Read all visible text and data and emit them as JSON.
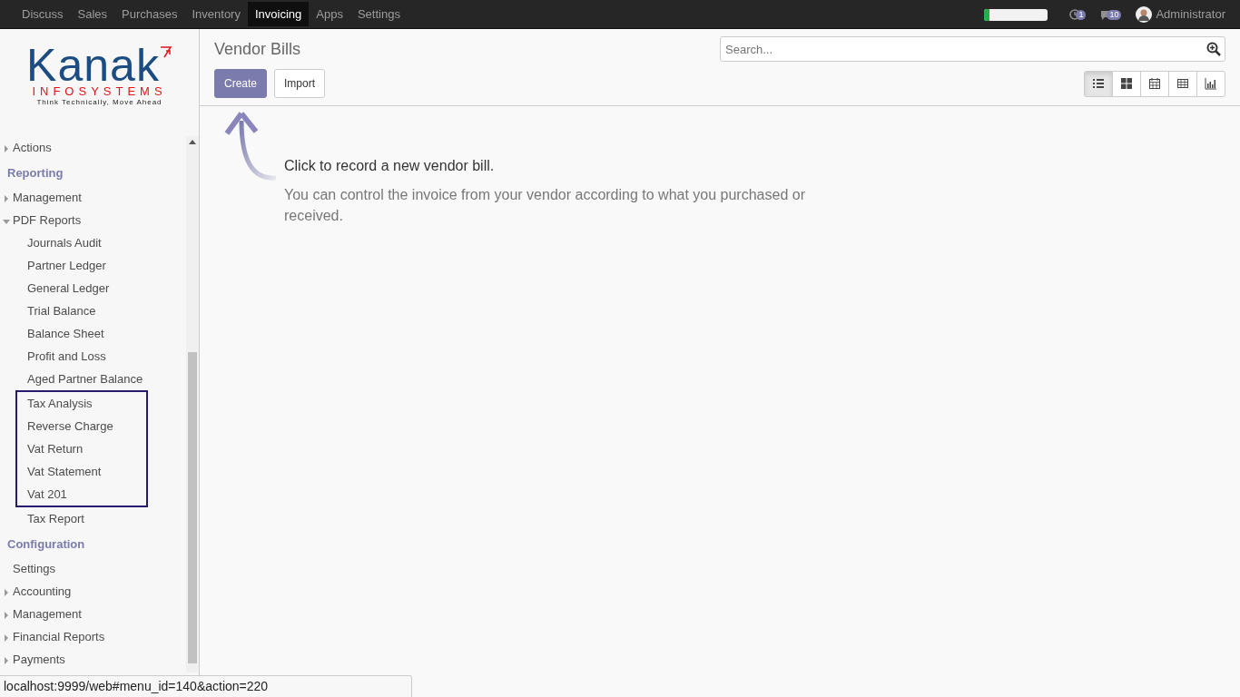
{
  "top_menu": [
    {
      "label": "Discuss",
      "selected": false
    },
    {
      "label": "Sales",
      "selected": false
    },
    {
      "label": "Purchases",
      "selected": false
    },
    {
      "label": "Inventory",
      "selected": false
    },
    {
      "label": "Invoicing",
      "selected": true
    },
    {
      "label": "Apps",
      "selected": false
    },
    {
      "label": "Settings",
      "selected": false
    }
  ],
  "systray": {
    "progress": {
      "level": 0.08
    },
    "activity_count": "1",
    "message_count": "10",
    "user": "Administrator"
  },
  "logo": {
    "name": "Kanak",
    "subtitle": "INFOSYSTEMS",
    "tagline": "Think Technically, Move Ahead"
  },
  "sidebar": {
    "entries": [
      {
        "kind": "folder",
        "label": "Actions",
        "expanded": false
      },
      {
        "kind": "header",
        "label": "Reporting"
      },
      {
        "kind": "folder",
        "label": "Management",
        "expanded": false
      },
      {
        "kind": "folder",
        "label": "PDF Reports",
        "expanded": true,
        "children": [
          {
            "label": "Journals Audit",
            "highlighted": false
          },
          {
            "label": "Partner Ledger",
            "highlighted": false
          },
          {
            "label": "General Ledger",
            "highlighted": false
          },
          {
            "label": "Trial Balance",
            "highlighted": false
          },
          {
            "label": "Balance Sheet",
            "highlighted": false
          },
          {
            "label": "Profit and Loss",
            "highlighted": false
          },
          {
            "label": "Aged Partner Balance",
            "highlighted": false
          },
          {
            "label": "Tax Analysis",
            "highlighted": true
          },
          {
            "label": "Reverse Charge",
            "highlighted": true
          },
          {
            "label": "Vat Return",
            "highlighted": true
          },
          {
            "label": "Vat Statement",
            "highlighted": true
          },
          {
            "label": "Vat 201",
            "highlighted": true
          },
          {
            "label": "Tax Report",
            "highlighted": false
          }
        ]
      },
      {
        "kind": "header",
        "label": "Configuration"
      },
      {
        "kind": "link",
        "label": "Settings"
      },
      {
        "kind": "folder",
        "label": "Accounting",
        "expanded": false
      },
      {
        "kind": "folder",
        "label": "Management",
        "expanded": false
      },
      {
        "kind": "folder",
        "label": "Financial Reports",
        "expanded": false
      },
      {
        "kind": "folder",
        "label": "Payments",
        "expanded": false
      }
    ]
  },
  "breadcrumb": "Vendor Bills",
  "search": {
    "placeholder": "Search..."
  },
  "buttons": [
    {
      "label": "Create",
      "kind": "primary"
    },
    {
      "label": "Import",
      "kind": "secondary"
    }
  ],
  "views": [
    {
      "kind": "list",
      "selected": true
    },
    {
      "kind": "kanban",
      "selected": false
    },
    {
      "kind": "calendar",
      "selected": false
    },
    {
      "kind": "pivot",
      "selected": false
    },
    {
      "kind": "graph",
      "selected": false
    }
  ],
  "help": {
    "title": "Click to record a new vendor bill.",
    "text": "You can control the invoice from your vendor according to what you purchased or received."
  },
  "status_url": "localhost:9999/web#menu_id=140&action=220"
}
